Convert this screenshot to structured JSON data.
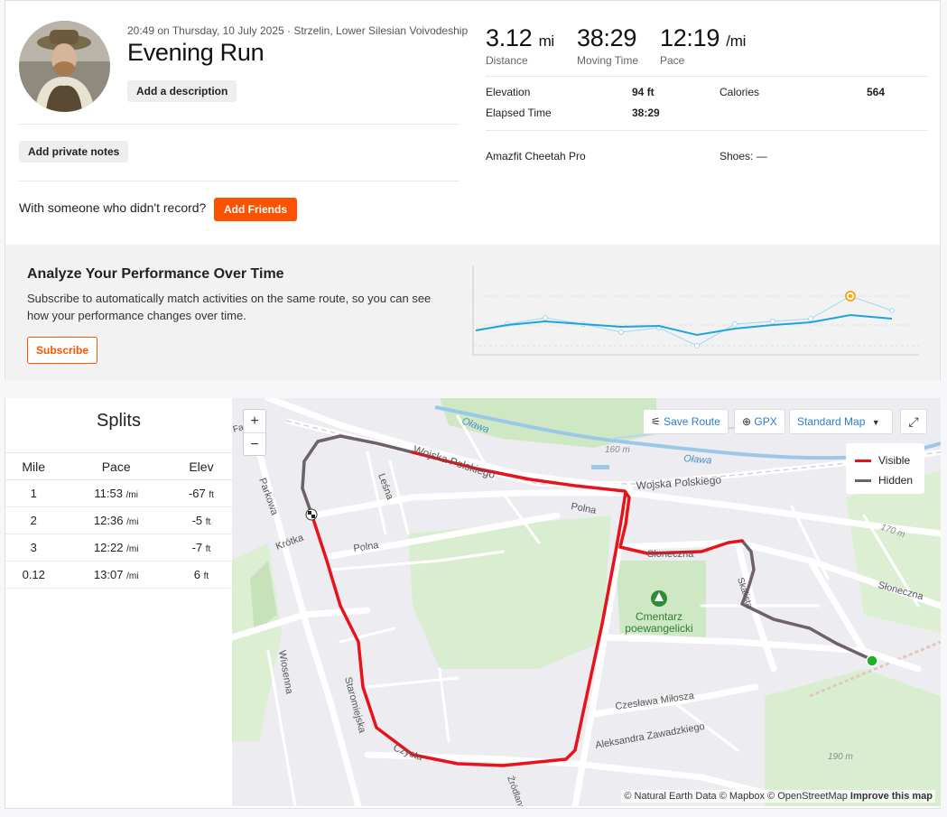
{
  "activity": {
    "meta": "20:49 on Thursday, 10 July 2025 · Strzelin, Lower Silesian Voivodeship",
    "title": "Evening Run",
    "add_description": "Add a description",
    "add_private_notes": "Add private notes",
    "friends_text": "With someone who didn't record?",
    "add_friends": "Add Friends"
  },
  "stats": {
    "distance": {
      "value": "3.12",
      "unit": "mi",
      "label": "Distance"
    },
    "moving_time": {
      "value": "38:29",
      "label": "Moving Time"
    },
    "pace": {
      "value": "12:19",
      "unit": "/mi",
      "label": "Pace"
    },
    "elevation_label": "Elevation",
    "elevation": "94 ft",
    "calories_label": "Calories",
    "calories": "564",
    "elapsed_label": "Elapsed Time",
    "elapsed": "38:29",
    "device": "Amazfit Cheetah Pro",
    "shoes": "Shoes: —"
  },
  "promo": {
    "title": "Analyze Your Performance Over Time",
    "body": "Subscribe to automatically match activities on the same route, so you can see how your performance changes over time.",
    "button": "Subscribe",
    "colors": {
      "line": "#1fa3dc",
      "highlight": "#f5a623"
    }
  },
  "splits": {
    "title": "Splits",
    "headers": [
      "Mile",
      "Pace",
      "Elev"
    ],
    "rows": [
      {
        "mile": "1",
        "pace": "11:53",
        "pace_unit": "/mi",
        "elev": "-67",
        "elev_unit": "ft"
      },
      {
        "mile": "2",
        "pace": "12:36",
        "pace_unit": "/mi",
        "elev": "-5",
        "elev_unit": "ft"
      },
      {
        "mile": "3",
        "pace": "12:22",
        "pace_unit": "/mi",
        "elev": "-7",
        "elev_unit": "ft"
      },
      {
        "mile": "0.12",
        "pace": "13:07",
        "pace_unit": "/mi",
        "elev": "6",
        "elev_unit": "ft"
      }
    ]
  },
  "map": {
    "zoom_in": "+",
    "zoom_out": "−",
    "save_route": "Save Route",
    "gpx": "GPX",
    "map_type": "Standard Map",
    "legend": {
      "visible": "Visible",
      "hidden": "Hidden",
      "visible_color": "#e8121a",
      "hidden_color": "#6d6268"
    },
    "attribution": "© Natural Earth Data © Mapbox © OpenStreetMap",
    "improve": "Improve this map",
    "labels": {
      "river1": "Oława",
      "river2": "Oława",
      "wojska1": "Wojska Polskiego",
      "wojska2": "Wojska Polskiego",
      "lesna": "Leśna",
      "polna1": "Polna",
      "polna2": "Polna",
      "krotka": "Krótka",
      "parkowa": "Parkowa",
      "sloneczna1": "Słoneczna",
      "sloneczna2": "Słoneczna",
      "skalista": "Skalista",
      "cemetery": "Cmentarz",
      "cemetery2": "poewangelicki",
      "wiosenna": "Wiosenna",
      "staromiejska": "Staromiejska",
      "milosza": "Czesława Miłosza",
      "zawadzkiego": "Aleksandra Zawadzkiego",
      "czysta": "Czysta",
      "zrodlana": "Źródlana",
      "c160": "160 m",
      "c170": "170 m",
      "c190": "190 m",
      "farn": "Farna"
    }
  }
}
